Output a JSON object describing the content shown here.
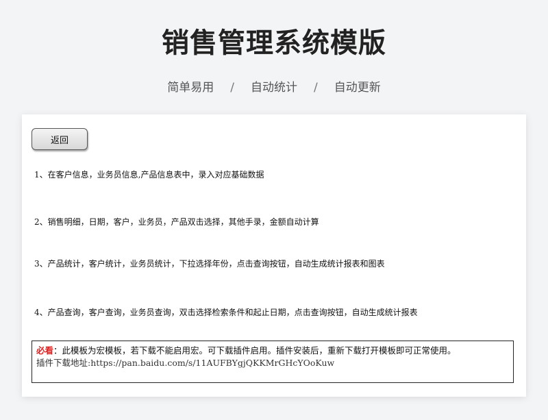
{
  "header": {
    "title": "销售管理系统模版",
    "tags": [
      "简单易用",
      "自动统计",
      "自动更新"
    ],
    "separator": "/"
  },
  "card": {
    "back_label": "返回",
    "steps": [
      "1、在客户信息，业务员信息,产品信息表中，录入对应基础数据",
      "2、销售明细，日期，客户，业务员，产品双击选择，其他手录，金额自动计算",
      "3、产品统计，客户统计，业务员统计，下拉选择年份，点击查询按钮，自动生成统计报表和图表",
      "4、产品查询，客户查询，业务员查询，双击选择检索条件和起止日期，点击查询按钮，自动生成统计报表"
    ],
    "notice": {
      "must_label": "必看",
      "text": "：此模板为宏模板，若下载不能启用宏。可下载插件启用。插件安装后，重新下载打开模板即可正常使用。",
      "url_line": "插件下载地址:https://pan.baidu.com/s/11AUFBYgjQKKMrGHcYOoKuw"
    }
  }
}
